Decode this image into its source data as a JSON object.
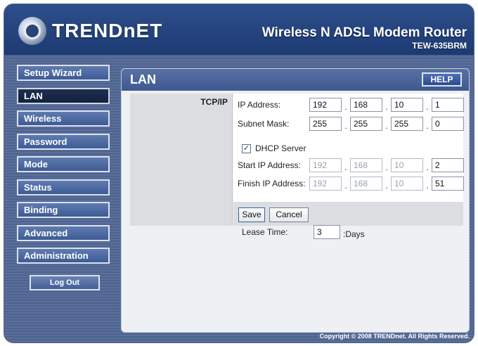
{
  "header": {
    "logo_text": "TRENDnET",
    "product_title": "Wireless N ADSL Modem Router",
    "product_model": "TEW-635BRM"
  },
  "sidebar": {
    "items": [
      {
        "label": "Setup Wizard"
      },
      {
        "label": "LAN"
      },
      {
        "label": "Wireless"
      },
      {
        "label": "Password"
      },
      {
        "label": "Mode"
      },
      {
        "label": "Status"
      },
      {
        "label": "Binding"
      },
      {
        "label": "Advanced"
      },
      {
        "label": "Administration"
      }
    ],
    "active": "LAN",
    "logout_label": "Log Out"
  },
  "panel": {
    "title": "LAN",
    "help_label": "HELP",
    "section_label": "TCP/IP",
    "ip_address": {
      "label": "IP Address:",
      "octets": [
        "192",
        "168",
        "10",
        "1"
      ]
    },
    "subnet_mask": {
      "label": "Subnet Mask:",
      "octets": [
        "255",
        "255",
        "255",
        "0"
      ]
    },
    "dhcp": {
      "label": "DHCP Server",
      "checked": true,
      "check_glyph": "✓"
    },
    "start_ip": {
      "label": "Start IP Address:",
      "octets": [
        "192",
        "168",
        "10",
        "2"
      ]
    },
    "finish_ip": {
      "label": "Finish IP Address:",
      "octets": [
        "192",
        "168",
        "10",
        "51"
      ]
    },
    "lease": {
      "label": "Lease Time:",
      "value": "3",
      "unit": ":Days"
    },
    "save_label": "Save",
    "cancel_label": "Cancel"
  },
  "footer": {
    "copyright": "Copyright © 2008 TRENDnet. All Rights Reserved."
  }
}
